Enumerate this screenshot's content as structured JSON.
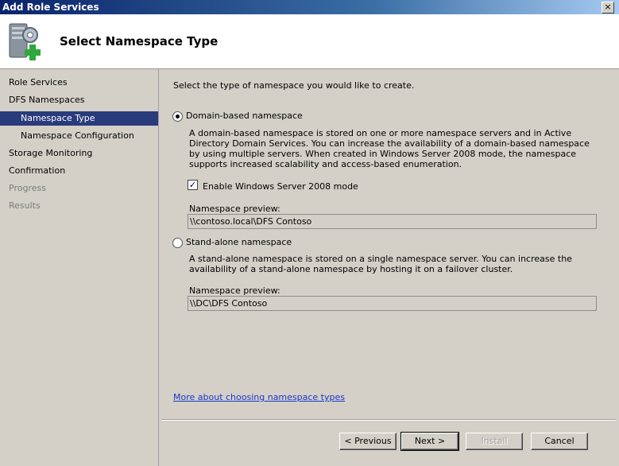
{
  "window": {
    "title": "Add Role Services",
    "close_glyph": "×"
  },
  "header": {
    "title": "Select Namespace Type",
    "icon": "server-add-icon"
  },
  "nav": {
    "items": [
      {
        "label": "Role Services",
        "state": "normal"
      },
      {
        "label": "DFS Namespaces",
        "state": "normal"
      },
      {
        "label": "Namespace Type",
        "state": "selected"
      },
      {
        "label": "Namespace Configuration",
        "state": "normal"
      },
      {
        "label": "Storage Monitoring",
        "state": "normal"
      },
      {
        "label": "Confirmation",
        "state": "normal"
      },
      {
        "label": "Progress",
        "state": "disabled"
      },
      {
        "label": "Results",
        "state": "disabled"
      }
    ]
  },
  "main": {
    "instruction": "Select the type of namespace you would like to create.",
    "domain": {
      "label": "Domain-based namespace",
      "selected": true,
      "description": "A domain-based namespace is stored on one or more namespace servers and in Active Directory Domain Services. You can increase the availability of a domain-based namespace by using multiple servers. When created in Windows Server 2008 mode, the namespace supports increased scalability and access-based enumeration.",
      "mode_label": "Enable Windows Server 2008 mode",
      "mode_checked": true,
      "preview_label": "Namespace preview:",
      "preview_value": "\\\\contoso.local\\DFS Contoso"
    },
    "standalone": {
      "label": "Stand-alone namespace",
      "selected": false,
      "description": "A stand-alone namespace is stored on a single namespace server. You can increase the availability of a stand-alone namespace by hosting it on a failover cluster.",
      "preview_label": "Namespace preview:",
      "preview_value": "\\\\DC\\DFS Contoso"
    },
    "help_link": "More about choosing namespace types"
  },
  "buttons": {
    "previous": "< Previous",
    "next": "Next >",
    "install": "Install",
    "cancel": "Cancel"
  }
}
